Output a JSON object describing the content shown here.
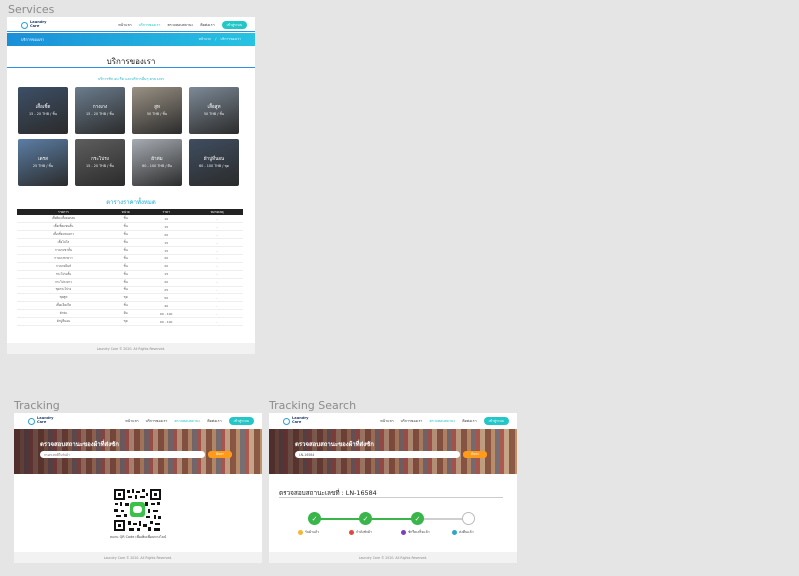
{
  "frames": {
    "services_label": "Services",
    "tracking_label": "Tracking",
    "tracking_search_label": "Tracking Search"
  },
  "brand": {
    "logo_text_1": "Laundry",
    "logo_text_2": "Care"
  },
  "nav": {
    "items": [
      "หน้าแรก",
      "บริการของเรา",
      "ตรวจสอบสถานะ",
      "ติดต่อเรา"
    ],
    "cta": "เข้าสู่ระบบ"
  },
  "services": {
    "banner_title": "บริการของเรา",
    "crumb_home": "หน้าแรก",
    "crumb_sep": "/",
    "crumb_current": "บริการของเรา",
    "title": "บริการของเรา",
    "subtitle": "บริการซัก อบ รีด และบริการอื่นๆ ครบวงจร",
    "cards": [
      {
        "name": "เสื้อเชิ้ต",
        "price": "15 - 20 THB / ชิ้น",
        "color": "#3d4f66"
      },
      {
        "name": "กางเกง",
        "price": "15 - 20 THB / ชิ้น",
        "color": "#6b7d8e"
      },
      {
        "name": "สูท",
        "price": "50 THB / ชิ้น",
        "color": "#9a9184"
      },
      {
        "name": "เสื้อสูท",
        "price": "50 THB / ชิ้น",
        "color": "#7d8a97"
      },
      {
        "name": "เดรส",
        "price": "25 THB / ชิ้น",
        "color": "#5b7ea5"
      },
      {
        "name": "กระโปรง",
        "price": "15 - 20 THB / ชิ้น",
        "color": "#5e5e5e"
      },
      {
        "name": "ผ้าห่ม",
        "price": "60 - 100 THB / ผืน",
        "color": "#a7acb3"
      },
      {
        "name": "ผ้าปูที่นอน",
        "price": "60 - 100 THB / ชุด",
        "color": "#3f4d60"
      }
    ],
    "table_title": "ตารางราคาทั้งหมด",
    "table_headers": [
      "รายการ",
      "หน่วย",
      "ราคา",
      "หมายเหตุ"
    ],
    "table_rows": [
      [
        "เสื้อยืด/เสื้อคอกลม",
        "ชิ้น",
        "10",
        "-"
      ],
      [
        "เสื้อเชิ้ตแขนสั้น",
        "ชิ้น",
        "15",
        "-"
      ],
      [
        "เสื้อเชิ้ตแขนยาว",
        "ชิ้น",
        "20",
        "-"
      ],
      [
        "เสื้อโปโล",
        "ชิ้น",
        "15",
        "-"
      ],
      [
        "กางเกงขาสั้น",
        "ชิ้น",
        "15",
        "-"
      ],
      [
        "กางเกงขายาว",
        "ชิ้น",
        "20",
        "-"
      ],
      [
        "กางเกงยีนส์",
        "ชิ้น",
        "20",
        "-"
      ],
      [
        "กระโปรงสั้น",
        "ชิ้น",
        "15",
        "-"
      ],
      [
        "กระโปรงยาว",
        "ชิ้น",
        "20",
        "-"
      ],
      [
        "ชุดกระโปรง",
        "ชิ้น",
        "25",
        "-"
      ],
      [
        "ชุดสูท",
        "ชุด",
        "50",
        "-"
      ],
      [
        "เสื้อแจ็คเก็ต",
        "ชิ้น",
        "40",
        "-"
      ],
      [
        "ผ้าห่ม",
        "ผืน",
        "60 - 100",
        "-"
      ],
      [
        "ผ้าปูที่นอน",
        "ชุด",
        "60 - 100",
        "-"
      ]
    ],
    "footer": "Laundry Care © 2020. All Rights Reserved."
  },
  "tracking": {
    "hero_title": "ตรวจสอบสถานะของผ้าที่ส่งซัก",
    "input_placeholder": "กรอกเลขที่ใบรับผ้า",
    "button": "ค้นหา",
    "qr_caption": "สแกน QR Code เพื่อเพิ่มเพื่อนทางไลน์",
    "footer": "Laundry Care © 2020. All Rights Reserved."
  },
  "tracking_search": {
    "hero_title": "ตรวจสอบสถานะของผ้าที่ส่งซัก",
    "input_value": "LN-16584",
    "button": "ค้นหา",
    "status_title": "ตรวจสอบสถานะเลขที่ : LN-16584",
    "steps": [
      {
        "label": "รับผ้าแล้ว",
        "done": true,
        "icon_color": "#f5b731"
      },
      {
        "label": "กำลังซักผ้า",
        "done": true,
        "icon_color": "#e0483e"
      },
      {
        "label": "ซักรีดเสร็จแล้ว",
        "done": true,
        "icon_color": "#7c3fbf"
      },
      {
        "label": "ส่งคืนแล้ว",
        "done": false,
        "icon_color": "#2fa6c9"
      }
    ],
    "check_glyph": "✓",
    "footer": "Laundry Care © 2020. All Rights Reserved."
  }
}
